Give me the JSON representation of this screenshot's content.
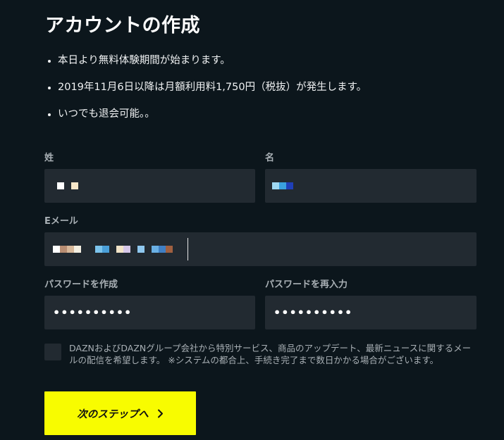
{
  "page": {
    "title": "アカウントの作成"
  },
  "benefits": [
    "本日より無料体験期間が始まります。",
    "2019年11月6日以降は月額利用料1,750円（税抜）が発生します。",
    "いつでも退会可能。。"
  ],
  "form": {
    "last_name_label": "姓",
    "first_name_label": "名",
    "email_label": "Eメール",
    "password_label": "パスワードを作成",
    "password_confirm_label": "パスワードを再入力",
    "password_mask": "••••••••••",
    "password_confirm_mask": "••••••••••"
  },
  "consent": {
    "text": "DAZNおよびDAZNグループ会社から特別サービス、商品のアップデート、最新ニュースに関するメールの配信を希望します。 ※システムの都合上、手続き完了まで数日かかる場合がございます。"
  },
  "button": {
    "next_label": "次のステップへ",
    "icon": "chevron-right-icon"
  },
  "colors": {
    "background": "#0c161c",
    "field": "#222a31",
    "accent": "#f8fc00"
  }
}
